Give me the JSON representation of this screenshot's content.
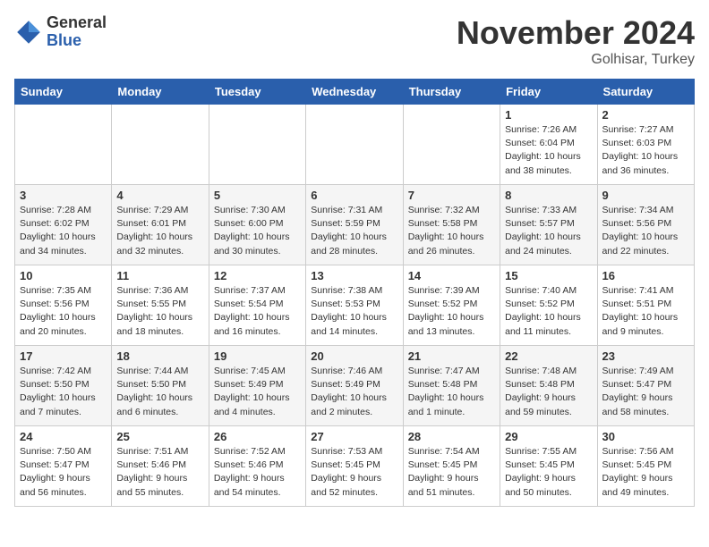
{
  "logo": {
    "general": "General",
    "blue": "Blue"
  },
  "title": "November 2024",
  "subtitle": "Golhisar, Turkey",
  "days_of_week": [
    "Sunday",
    "Monday",
    "Tuesday",
    "Wednesday",
    "Thursday",
    "Friday",
    "Saturday"
  ],
  "weeks": [
    [
      {
        "day": "",
        "info": ""
      },
      {
        "day": "",
        "info": ""
      },
      {
        "day": "",
        "info": ""
      },
      {
        "day": "",
        "info": ""
      },
      {
        "day": "",
        "info": ""
      },
      {
        "day": "1",
        "info": "Sunrise: 7:26 AM\nSunset: 6:04 PM\nDaylight: 10 hours and 38 minutes."
      },
      {
        "day": "2",
        "info": "Sunrise: 7:27 AM\nSunset: 6:03 PM\nDaylight: 10 hours and 36 minutes."
      }
    ],
    [
      {
        "day": "3",
        "info": "Sunrise: 7:28 AM\nSunset: 6:02 PM\nDaylight: 10 hours and 34 minutes."
      },
      {
        "day": "4",
        "info": "Sunrise: 7:29 AM\nSunset: 6:01 PM\nDaylight: 10 hours and 32 minutes."
      },
      {
        "day": "5",
        "info": "Sunrise: 7:30 AM\nSunset: 6:00 PM\nDaylight: 10 hours and 30 minutes."
      },
      {
        "day": "6",
        "info": "Sunrise: 7:31 AM\nSunset: 5:59 PM\nDaylight: 10 hours and 28 minutes."
      },
      {
        "day": "7",
        "info": "Sunrise: 7:32 AM\nSunset: 5:58 PM\nDaylight: 10 hours and 26 minutes."
      },
      {
        "day": "8",
        "info": "Sunrise: 7:33 AM\nSunset: 5:57 PM\nDaylight: 10 hours and 24 minutes."
      },
      {
        "day": "9",
        "info": "Sunrise: 7:34 AM\nSunset: 5:56 PM\nDaylight: 10 hours and 22 minutes."
      }
    ],
    [
      {
        "day": "10",
        "info": "Sunrise: 7:35 AM\nSunset: 5:56 PM\nDaylight: 10 hours and 20 minutes."
      },
      {
        "day": "11",
        "info": "Sunrise: 7:36 AM\nSunset: 5:55 PM\nDaylight: 10 hours and 18 minutes."
      },
      {
        "day": "12",
        "info": "Sunrise: 7:37 AM\nSunset: 5:54 PM\nDaylight: 10 hours and 16 minutes."
      },
      {
        "day": "13",
        "info": "Sunrise: 7:38 AM\nSunset: 5:53 PM\nDaylight: 10 hours and 14 minutes."
      },
      {
        "day": "14",
        "info": "Sunrise: 7:39 AM\nSunset: 5:52 PM\nDaylight: 10 hours and 13 minutes."
      },
      {
        "day": "15",
        "info": "Sunrise: 7:40 AM\nSunset: 5:52 PM\nDaylight: 10 hours and 11 minutes."
      },
      {
        "day": "16",
        "info": "Sunrise: 7:41 AM\nSunset: 5:51 PM\nDaylight: 10 hours and 9 minutes."
      }
    ],
    [
      {
        "day": "17",
        "info": "Sunrise: 7:42 AM\nSunset: 5:50 PM\nDaylight: 10 hours and 7 minutes."
      },
      {
        "day": "18",
        "info": "Sunrise: 7:44 AM\nSunset: 5:50 PM\nDaylight: 10 hours and 6 minutes."
      },
      {
        "day": "19",
        "info": "Sunrise: 7:45 AM\nSunset: 5:49 PM\nDaylight: 10 hours and 4 minutes."
      },
      {
        "day": "20",
        "info": "Sunrise: 7:46 AM\nSunset: 5:49 PM\nDaylight: 10 hours and 2 minutes."
      },
      {
        "day": "21",
        "info": "Sunrise: 7:47 AM\nSunset: 5:48 PM\nDaylight: 10 hours and 1 minute."
      },
      {
        "day": "22",
        "info": "Sunrise: 7:48 AM\nSunset: 5:48 PM\nDaylight: 9 hours and 59 minutes."
      },
      {
        "day": "23",
        "info": "Sunrise: 7:49 AM\nSunset: 5:47 PM\nDaylight: 9 hours and 58 minutes."
      }
    ],
    [
      {
        "day": "24",
        "info": "Sunrise: 7:50 AM\nSunset: 5:47 PM\nDaylight: 9 hours and 56 minutes."
      },
      {
        "day": "25",
        "info": "Sunrise: 7:51 AM\nSunset: 5:46 PM\nDaylight: 9 hours and 55 minutes."
      },
      {
        "day": "26",
        "info": "Sunrise: 7:52 AM\nSunset: 5:46 PM\nDaylight: 9 hours and 54 minutes."
      },
      {
        "day": "27",
        "info": "Sunrise: 7:53 AM\nSunset: 5:45 PM\nDaylight: 9 hours and 52 minutes."
      },
      {
        "day": "28",
        "info": "Sunrise: 7:54 AM\nSunset: 5:45 PM\nDaylight: 9 hours and 51 minutes."
      },
      {
        "day": "29",
        "info": "Sunrise: 7:55 AM\nSunset: 5:45 PM\nDaylight: 9 hours and 50 minutes."
      },
      {
        "day": "30",
        "info": "Sunrise: 7:56 AM\nSunset: 5:45 PM\nDaylight: 9 hours and 49 minutes."
      }
    ]
  ]
}
